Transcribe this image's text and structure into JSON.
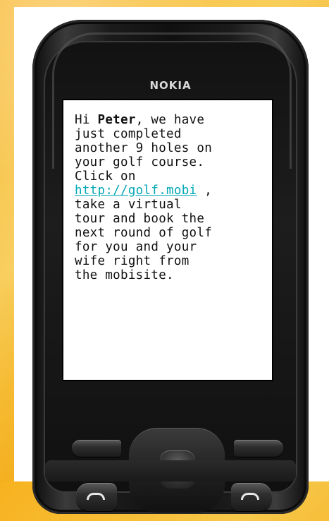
{
  "phone": {
    "brand": "NOKIA"
  },
  "message": {
    "lines": [
      [
        {
          "text": "Hi "
        },
        {
          "text": "Peter",
          "bold": true
        },
        {
          "text": ", we have"
        }
      ],
      [
        {
          "text": "just completed"
        }
      ],
      [
        {
          "text": "another 9 holes on"
        }
      ],
      [
        {
          "text": "your golf course."
        }
      ],
      [
        {
          "text": "Click on"
        }
      ],
      [
        {
          "text": "http://golf.mobi",
          "link": true
        },
        {
          "text": " ,"
        }
      ],
      [
        {
          "text": "take a virtual"
        }
      ],
      [
        {
          "text": "tour and book the"
        }
      ],
      [
        {
          "text": "next round of golf"
        }
      ],
      [
        {
          "text": "for you and your"
        }
      ],
      [
        {
          "text": "wife right from"
        }
      ],
      [
        {
          "text": "the mobisite."
        }
      ]
    ]
  },
  "colors": {
    "background": "#f7b21f",
    "link": "#00a7b5",
    "phone_body": "#101010",
    "screen": "#ffffff"
  },
  "icons": {
    "call": "handset-icon",
    "end": "handset-icon"
  }
}
